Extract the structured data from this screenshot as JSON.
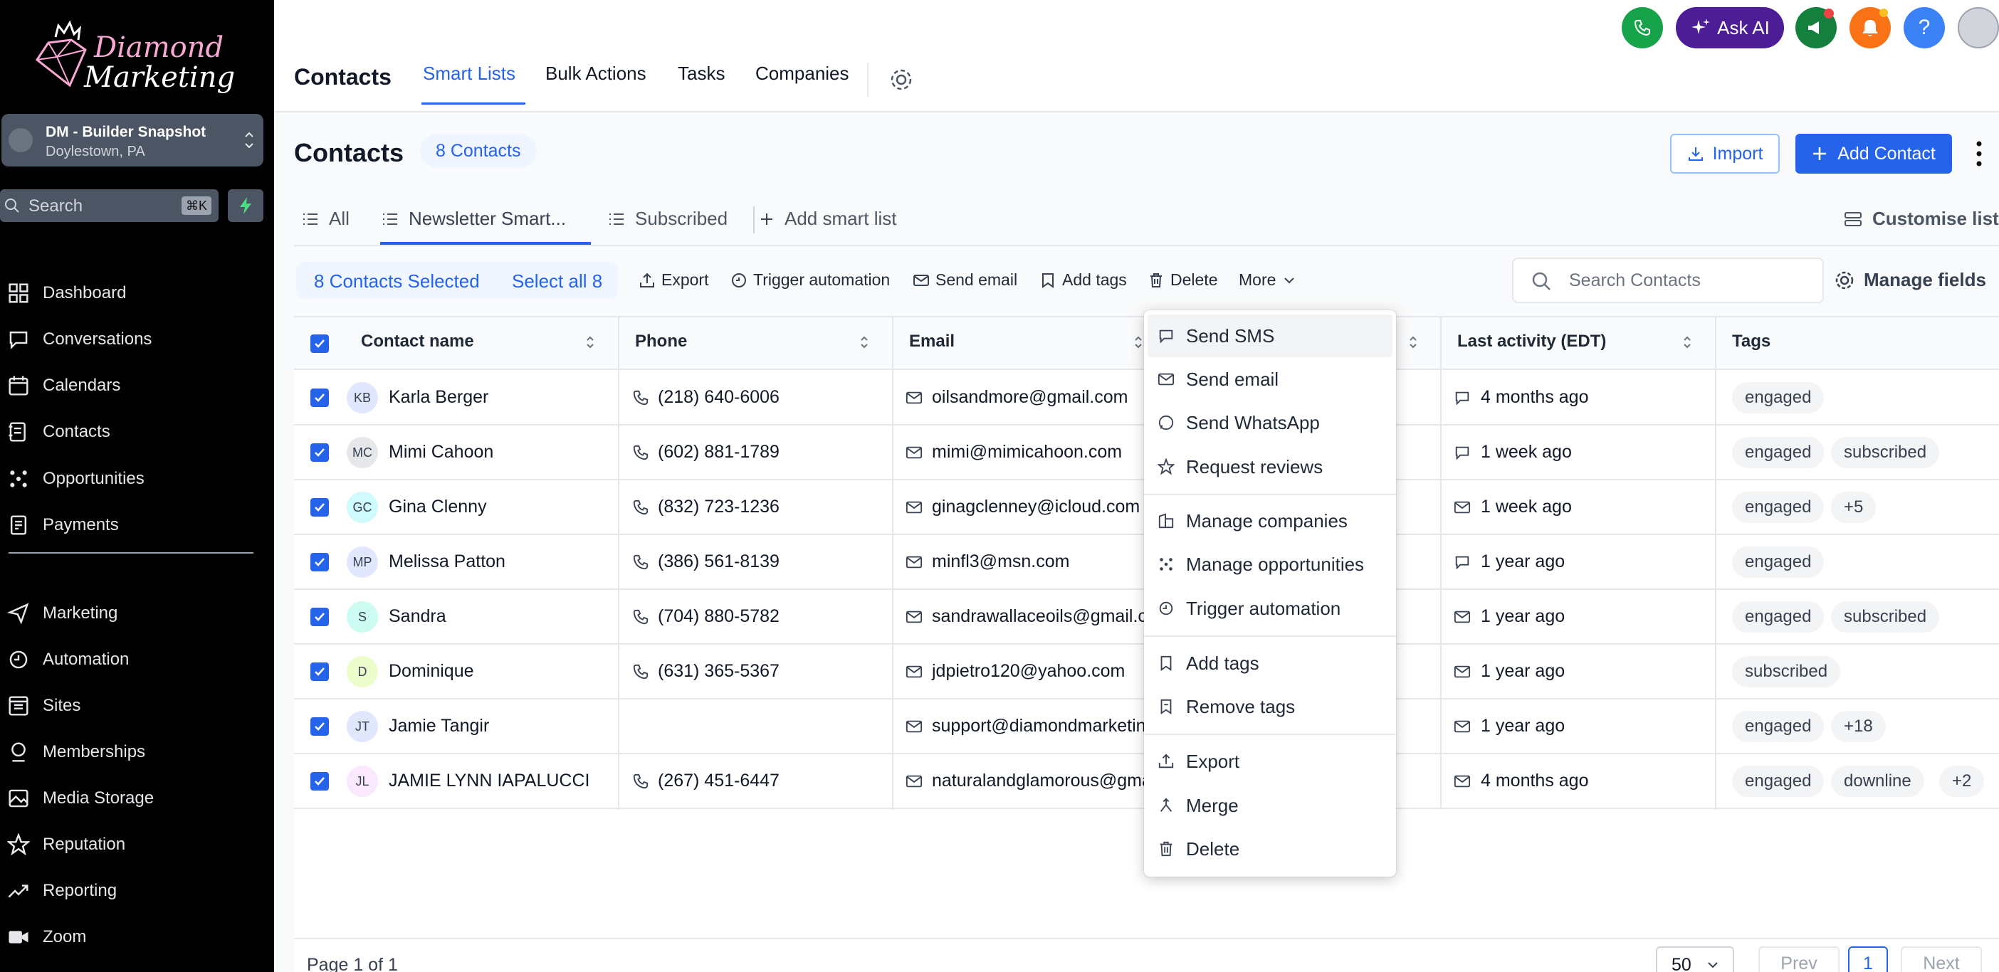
{
  "brand": {
    "logo_line1": "Diamond",
    "logo_line2": "Marketing"
  },
  "location": {
    "name": "DM - Builder Snapshot",
    "city": "Doylestown, PA"
  },
  "sidebar_search": {
    "placeholder": "Search",
    "shortcut": "⌘K"
  },
  "nav": [
    {
      "label": "Dashboard",
      "icon": "dashboard-icon"
    },
    {
      "label": "Conversations",
      "icon": "chat-icon"
    },
    {
      "label": "Calendars",
      "icon": "calendar-icon"
    },
    {
      "label": "Contacts",
      "icon": "contacts-icon"
    },
    {
      "label": "Opportunities",
      "icon": "opportunities-icon"
    },
    {
      "label": "Payments",
      "icon": "payments-icon"
    },
    {
      "label": "Marketing",
      "icon": "send-icon"
    },
    {
      "label": "Automation",
      "icon": "automation-icon"
    },
    {
      "label": "Sites",
      "icon": "sites-icon"
    },
    {
      "label": "Memberships",
      "icon": "membership-icon"
    },
    {
      "label": "Media Storage",
      "icon": "media-icon"
    },
    {
      "label": "Reputation",
      "icon": "star-icon"
    },
    {
      "label": "Reporting",
      "icon": "reporting-icon"
    },
    {
      "label": "Zoom",
      "icon": "video-icon"
    }
  ],
  "header": {
    "title": "Contacts",
    "tabs": [
      "Smart Lists",
      "Bulk Actions",
      "Tasks",
      "Companies"
    ],
    "active_tab": "Smart Lists",
    "ask_ai": "Ask AI"
  },
  "page": {
    "title": "Contacts",
    "count_badge": "8 Contacts",
    "import_label": "Import",
    "add_label": "Add Contact"
  },
  "list_tabs": [
    "All",
    "Newsletter Smart...",
    "Subscribed"
  ],
  "add_smart_list": "Add smart list",
  "customise": "Customise list",
  "bulk": {
    "selected": "8 Contacts Selected",
    "select_all": "Select all 8",
    "actions": [
      "Export",
      "Trigger automation",
      "Send email",
      "Add tags",
      "Delete",
      "More"
    ]
  },
  "search": {
    "placeholder": "Search Contacts"
  },
  "manage_fields": "Manage fields",
  "columns": [
    "Contact name",
    "Phone",
    "Email",
    "Last activity (EDT)",
    "Tags"
  ],
  "rows": [
    {
      "initials": "KB",
      "name": "Karla Berger",
      "phone": "(218) 640-6006",
      "email": "oilsandmore@gmail.com",
      "activity": "4 months ago",
      "activity_icon": "chat-icon",
      "tags": [
        "engaged"
      ],
      "avatar_color": "#e0e7ff"
    },
    {
      "initials": "MC",
      "name": "Mimi Cahoon",
      "phone": "(602) 881-1789",
      "email": "mimi@mimicahoon.com",
      "activity": "1 week ago",
      "activity_icon": "chat-icon",
      "tags": [
        "engaged",
        "subscribed"
      ],
      "avatar_color": "#e5e7eb"
    },
    {
      "initials": "GC",
      "name": "Gina Clenny",
      "phone": "(832) 723-1236",
      "email": "ginagclenney@icloud.com",
      "activity": "1 week ago",
      "activity_icon": "mail-icon",
      "tags": [
        "engaged",
        "+5"
      ],
      "avatar_color": "#cffafe"
    },
    {
      "initials": "MP",
      "name": "Melissa Patton",
      "phone": "(386) 561-8139",
      "email": "minfl3@msn.com",
      "activity": "1 year ago",
      "activity_icon": "chat-icon",
      "tags": [
        "engaged"
      ],
      "avatar_color": "#e0e7ff"
    },
    {
      "initials": "S",
      "name": "Sandra",
      "phone": "(704) 880-5782",
      "email": "sandrawallaceoils@gmail.com",
      "activity": "1 year ago",
      "activity_icon": "mail-icon",
      "tags": [
        "engaged",
        "subscribed"
      ],
      "avatar_color": "#ccfbf1"
    },
    {
      "initials": "D",
      "name": "Dominique",
      "phone": "(631) 365-5367",
      "email": "jdpietro120@yahoo.com",
      "activity": "1 year ago",
      "activity_icon": "mail-icon",
      "tags": [
        "subscribed"
      ],
      "avatar_color": "#ecfccb"
    },
    {
      "initials": "JT",
      "name": "Jamie Tangir",
      "phone": "",
      "email": "support@diamondmarketing.com",
      "activity": "1 year ago",
      "activity_icon": "mail-icon",
      "tags": [
        "engaged",
        "+18"
      ],
      "avatar_color": "#e0e7ff"
    },
    {
      "initials": "JL",
      "name": "JAMIE LYNN IAPALUCCI",
      "phone": "(267) 451-6447",
      "email": "naturalandglamorous@gmail.com",
      "activity": "4 months ago",
      "activity_icon": "mail-icon",
      "tags": [
        "engaged",
        "downline",
        "+2"
      ],
      "avatar_color": "#fae8ff"
    }
  ],
  "dropdown": [
    {
      "label": "Send SMS",
      "icon": "sms-icon"
    },
    {
      "label": "Send email",
      "icon": "mail-icon"
    },
    {
      "label": "Send WhatsApp",
      "icon": "whatsapp-icon"
    },
    {
      "label": "Request reviews",
      "icon": "star-icon"
    },
    {
      "label": "Manage companies",
      "icon": "company-icon"
    },
    {
      "label": "Manage opportunities",
      "icon": "opportunities-icon"
    },
    {
      "label": "Trigger automation",
      "icon": "automation-icon"
    },
    {
      "label": "Add tags",
      "icon": "tag-icon"
    },
    {
      "label": "Remove tags",
      "icon": "tag-remove-icon"
    },
    {
      "label": "Export",
      "icon": "export-icon"
    },
    {
      "label": "Merge",
      "icon": "merge-icon"
    },
    {
      "label": "Delete",
      "icon": "trash-icon"
    }
  ],
  "pagination": {
    "text": "Page 1 of 1",
    "page_size": "50",
    "prev": "Prev",
    "current": "1",
    "next": "Next"
  },
  "colors": {
    "accent": "#2563eb",
    "sidebar_bg": "#000000",
    "ask_ai_bg": "#4c1d95"
  }
}
